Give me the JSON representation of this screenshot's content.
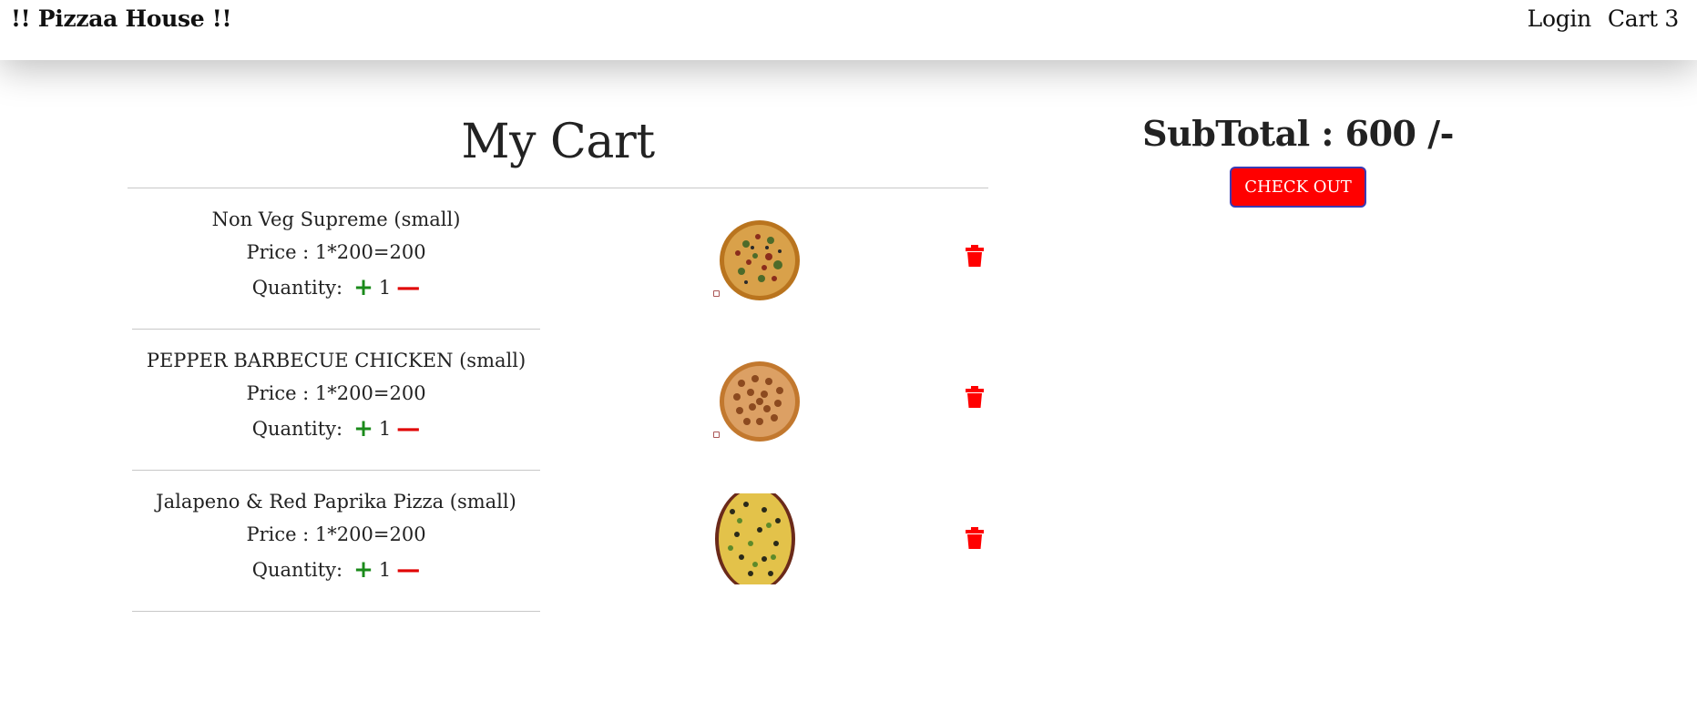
{
  "navbar": {
    "brand": "!! Pizzaa House !!",
    "login_label": "Login",
    "cart_label": "Cart 3"
  },
  "cart": {
    "title": "My Cart",
    "qty_label": "Quantity:",
    "items": [
      {
        "name": "Non Veg Supreme (small)",
        "price": "Price : 1*200=200",
        "quantity": "1"
      },
      {
        "name": "PEPPER BARBECUE CHICKEN (small)",
        "price": "Price : 1*200=200",
        "quantity": "1"
      },
      {
        "name": "Jalapeno & Red Paprika Pizza (small)",
        "price": "Price : 1*200=200",
        "quantity": "1"
      }
    ]
  },
  "summary": {
    "subtotal": "SubTotal : 600 /-",
    "checkout_label": "CHECK OUT"
  },
  "icons": {
    "plus": "plus-icon",
    "minus": "minus-icon",
    "delete": "trash-icon"
  },
  "colors": {
    "plus": "#1a8a1a",
    "minus": "#e00000",
    "delete": "#ff0000",
    "checkout_bg": "#ff0000"
  }
}
